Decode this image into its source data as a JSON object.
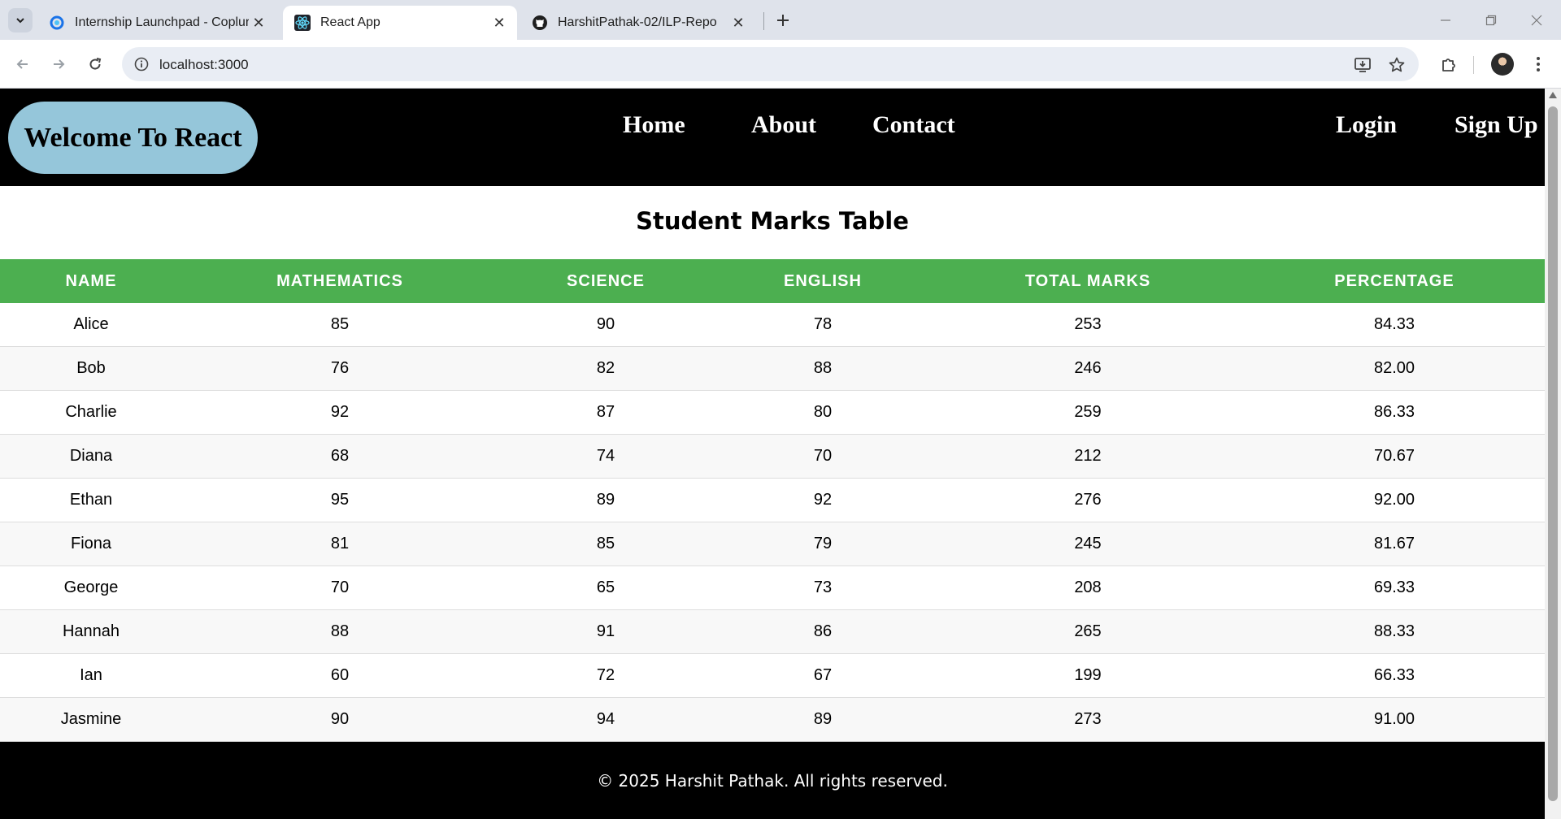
{
  "browser": {
    "tabs": [
      {
        "title": "Internship Launchpad - Coplur",
        "icon": "coplur-icon",
        "active": false
      },
      {
        "title": "React App",
        "icon": "react-icon",
        "active": true
      },
      {
        "title": "HarshitPathak-02/ILP-Repo",
        "icon": "github-icon",
        "active": false
      }
    ],
    "url": "localhost:3000"
  },
  "header": {
    "brand": "Welcome To React",
    "nav": {
      "home": "Home",
      "about": "About",
      "contact": "Contact"
    },
    "auth": {
      "login": "Login",
      "signup": "Sign Up"
    }
  },
  "page": {
    "title": "Student Marks Table"
  },
  "table": {
    "headers": [
      "NAME",
      "MATHEMATICS",
      "SCIENCE",
      "ENGLISH",
      "TOTAL MARKS",
      "PERCENTAGE"
    ],
    "rows": [
      [
        "Alice",
        "85",
        "90",
        "78",
        "253",
        "84.33"
      ],
      [
        "Bob",
        "76",
        "82",
        "88",
        "246",
        "82.00"
      ],
      [
        "Charlie",
        "92",
        "87",
        "80",
        "259",
        "86.33"
      ],
      [
        "Diana",
        "68",
        "74",
        "70",
        "212",
        "70.67"
      ],
      [
        "Ethan",
        "95",
        "89",
        "92",
        "276",
        "92.00"
      ],
      [
        "Fiona",
        "81",
        "85",
        "79",
        "245",
        "81.67"
      ],
      [
        "George",
        "70",
        "65",
        "73",
        "208",
        "69.33"
      ],
      [
        "Hannah",
        "88",
        "91",
        "86",
        "265",
        "88.33"
      ],
      [
        "Ian",
        "60",
        "72",
        "67",
        "199",
        "66.33"
      ],
      [
        "Jasmine",
        "90",
        "94",
        "89",
        "273",
        "91.00"
      ]
    ]
  },
  "footer": {
    "text": "© 2025 Harshit Pathak. All rights reserved."
  },
  "colors": {
    "header_bg": "#000000",
    "brand_pill": "#95c6da",
    "table_header": "#4caf50",
    "footer_bg": "#000000"
  }
}
